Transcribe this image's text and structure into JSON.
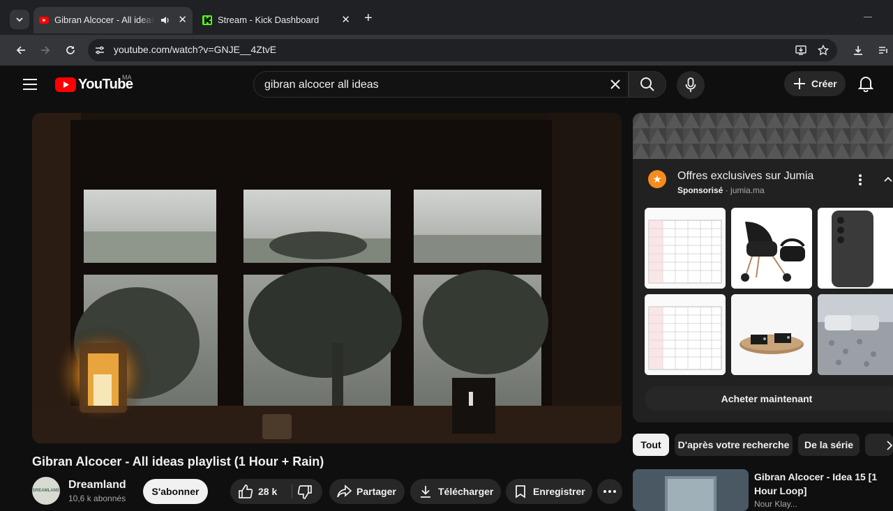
{
  "browser": {
    "tabs": [
      {
        "title": "Gibran Alcocer - All ideas playlist (1 Hour + Rain)",
        "active": true
      },
      {
        "title": "Stream - Kick Dashboard",
        "active": false
      }
    ],
    "url": "youtube.com/watch?v=GNJE__4ZtvE"
  },
  "yt": {
    "logo": "YouTube",
    "country": "MA",
    "search_query": "gibran alcocer all ideas",
    "create_label": "Créer"
  },
  "video": {
    "title": "Gibran Alcocer - All ideas playlist (1 Hour + Rain)",
    "channel": "Dreamland",
    "subscribers": "10,6 k abonnés",
    "avatar_text": "DREAMLAND",
    "subscribe_label": "S'abonner",
    "likes": "28 k",
    "share_label": "Partager",
    "download_label": "Télécharger",
    "save_label": "Enregistrer"
  },
  "ad": {
    "title": "Offres exclusives sur Jumia",
    "sponsored": "Sponsorisé",
    "domain": "jumia.ma",
    "cta": "Acheter maintenant"
  },
  "chips": [
    "Tout",
    "D'après votre recherche",
    "De la série"
  ],
  "recommendation": {
    "title": "Gibran Alcocer - Idea 15 [1 Hour Loop]",
    "channel": "Nour Klay..."
  },
  "colors": {
    "yt_red": "#ff0000",
    "kick_green": "#53fc18",
    "jumia_orange": "#f68b1e"
  }
}
